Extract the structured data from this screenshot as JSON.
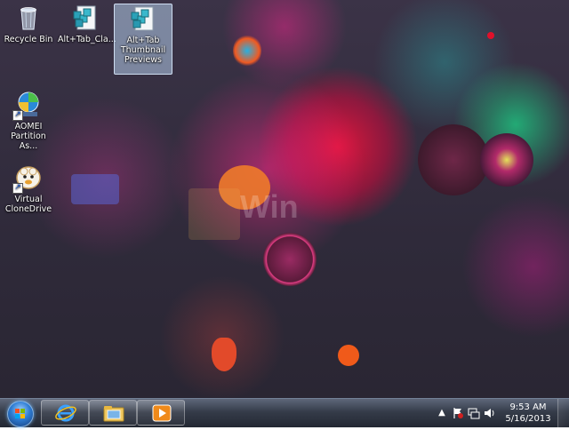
{
  "desktop": {
    "icons": [
      {
        "label": "Recycle Bin",
        "icon": "recycle-bin-icon"
      },
      {
        "label": "Alt+Tab_Cla...",
        "icon": "registry-file-icon"
      },
      {
        "label": "Alt+Tab Thumbnail Previews",
        "icon": "registry-file-icon"
      },
      {
        "label": "AOMEI Partition As...",
        "icon": "aomei-partition-icon"
      },
      {
        "label": "Virtual CloneDrive",
        "icon": "virtual-clonedrive-icon"
      }
    ],
    "watermark": "Win"
  },
  "taskbar": {
    "start": {
      "icon": "windows-start-orb-icon"
    },
    "pinned": [
      {
        "name": "Internet Explorer",
        "icon": "internet-explorer-icon"
      },
      {
        "name": "Windows Explorer",
        "icon": "folder-library-icon"
      },
      {
        "name": "Windows Media Player",
        "icon": "media-player-icon"
      }
    ],
    "tray": {
      "icons": [
        "show-hidden-icons-arrow",
        "action-center-flag-icon",
        "network-icon",
        "volume-icon"
      ],
      "time": "9:53 AM",
      "date": "5/16/2013"
    }
  },
  "colors": {
    "accent": "#2e7cd3",
    "selection": "#b4cdeb"
  }
}
